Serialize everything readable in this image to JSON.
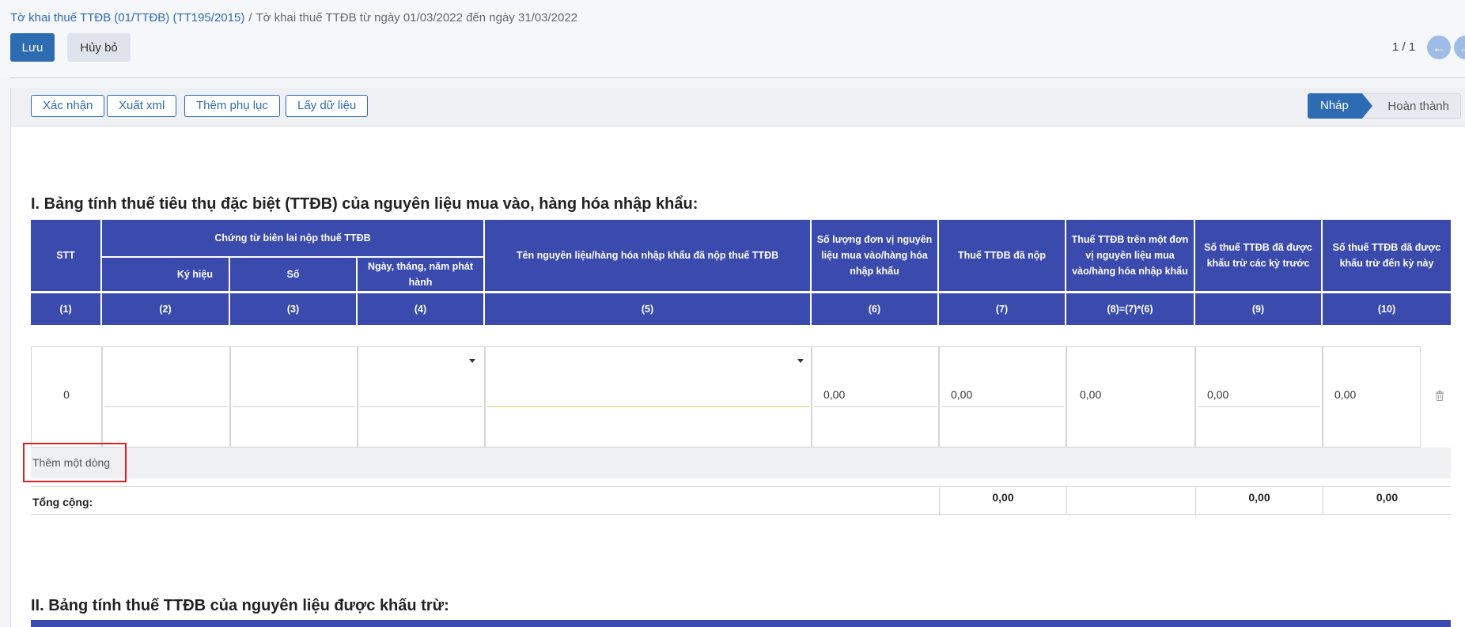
{
  "breadcrumb": {
    "parent": "Tờ khai thuế TTĐB (01/TTĐB) (TT195/2015)",
    "separator": "/",
    "current": "Tờ khai thuế TTĐB từ ngày 01/03/2022 đến ngày 31/03/2022"
  },
  "buttons": {
    "save": "Lưu",
    "discard": "Hủy bỏ"
  },
  "pager": {
    "value": "1 / 1",
    "prev_icon": "arrow-left-icon",
    "next_icon": "arrow-right-icon"
  },
  "statusbar": {
    "buttons": [
      "Xác nhận",
      "Xuất xml",
      "Thêm phụ lục",
      "Lấy dữ liệu"
    ],
    "stages": {
      "active": "Nháp",
      "inactive": "Hoàn thành"
    }
  },
  "section1": {
    "title": "I. Bảng tính thuế tiêu thụ đặc biệt (TTĐB) của nguyên liệu mua vào, hàng hóa nhập khẩu:",
    "headers": {
      "stt": "STT",
      "group": "Chứng từ biên lai nộp thuế TTĐB",
      "ky_hieu": "Ký hiệu",
      "so": "Số",
      "ngay": "Ngày, tháng, năm phát hành",
      "ten": "Tên nguyên liệu/hàng hóa nhập khẩu đã nộp thuế TTĐB",
      "so_luong": "Số lượng đơn vị nguyên liệu mua vào/hàng hóa nhập khẩu",
      "thue_da_nop": "Thuế TTĐB đã nộp",
      "thue_tren_dv": "Thuế TTĐB trên một đơn vị nguyên liệu mua vào/hàng hóa nhập khẩu",
      "da_khau_tru_truoc": "Số thuế TTĐB đã được khấu trừ các kỳ trước",
      "khau_tru_den_ky": "Số thuế TTĐB đã được khấu trừ đến kỳ này"
    },
    "column_numbers": [
      "(1)",
      "(2)",
      "(3)",
      "(4)",
      "(5)",
      "(6)",
      "(7)",
      "(8)=(7)*(6)",
      "(9)",
      "(10)"
    ],
    "row": {
      "stt": "0",
      "so_luong": "0,00",
      "thue_da_nop": "0,00",
      "thue_tren_dv": "0,00",
      "da_khau_tru_truoc": "0,00",
      "khau_tru_den_ky": "0,00"
    },
    "add_line": "Thêm một dòng",
    "totals": {
      "label": "Tổng cộng:",
      "thue_da_nop": "0,00",
      "da_khau_tru_truoc": "0,00",
      "khau_tru_den_ky": "0,00"
    }
  },
  "section2": {
    "title": "II. Bảng tính thuế TTĐB của nguyên liệu được khấu trừ:"
  }
}
